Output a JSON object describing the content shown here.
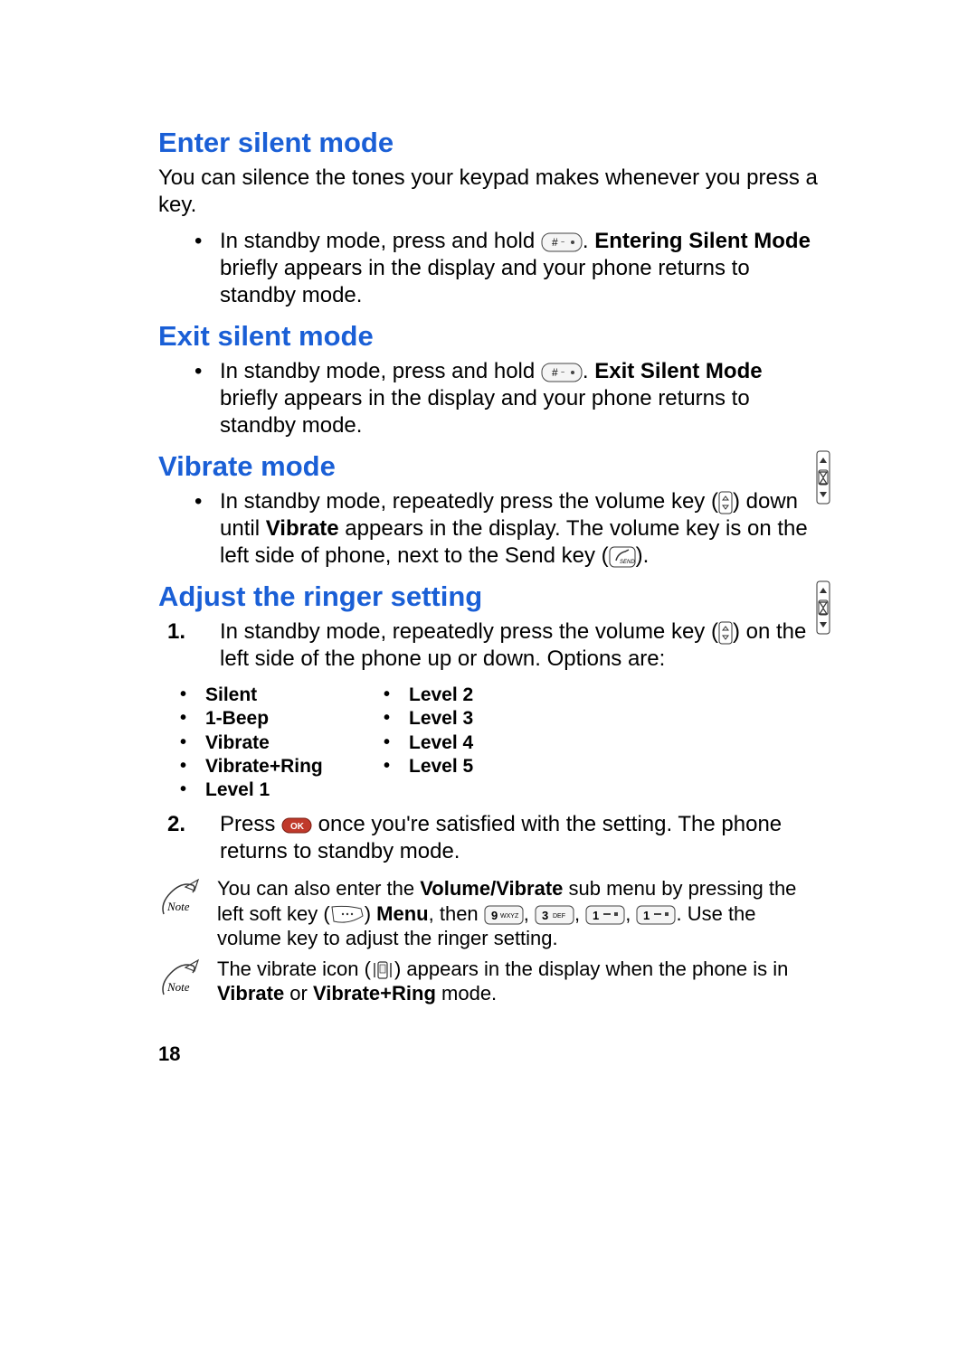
{
  "headings": {
    "enter": "Enter silent mode",
    "exit": "Exit silent mode",
    "vibrate": "Vibrate mode",
    "adjust": "Adjust the ringer setting"
  },
  "enter": {
    "intro": "You can silence the tones your keypad makes whenever you press a key.",
    "bullet_pre": "In standby mode, press and hold ",
    "bullet_post_bold": "Entering Silent Mode",
    "bullet_post_rest": " briefly appears in the display and your phone returns to standby mode."
  },
  "exit": {
    "bullet_pre": "In standby mode, press and hold ",
    "bullet_post_bold": "Exit Silent Mode",
    "bullet_post_rest": " briefly appears in the display and your phone returns to standby mode."
  },
  "vibrate": {
    "bullet_pre": "In standby mode, repeatedly press the volume key (",
    "bullet_mid": ") down until ",
    "bullet_bold": "Vibrate",
    "bullet_mid2": " appears in the display. The volume key is on the left side of phone, next to the Send key (",
    "bullet_post": ")."
  },
  "adjust": {
    "step1_pre": "In standby mode, repeatedly press the volume key (",
    "step1_post": ") on the left side of the phone up or down. Options are:",
    "step2_pre": "Press ",
    "step2_post": " once you're satisfied with the setting. The phone returns to standby mode.",
    "options_col1": [
      "Silent",
      "1-Beep",
      "Vibrate",
      "Vibrate+Ring",
      "Level 1"
    ],
    "options_col2": [
      "Level 2",
      "Level 3",
      "Level 4",
      "Level 5"
    ]
  },
  "notes": {
    "note1_pre": "You can also enter the ",
    "note1_bold": "Volume/Vibrate",
    "note1_mid": " sub menu by pressing the left soft key (",
    "note1_menu": "Menu",
    "note1_post": ". Use the volume key to adjust the ringer setting.",
    "note2_pre": "The vibrate icon (",
    "note2_mid": ") appears in the display when the phone is in ",
    "note2_bold1": "Vibrate",
    "note2_or": " or ",
    "note2_bold2": "Vibrate+Ring",
    "note2_post": " mode."
  },
  "misc": {
    "then": ", then ",
    "period_space": ". ",
    "dot_space": ". ",
    "comma_space": ", ",
    "close_paren_space": ") "
  },
  "page_number": "18"
}
